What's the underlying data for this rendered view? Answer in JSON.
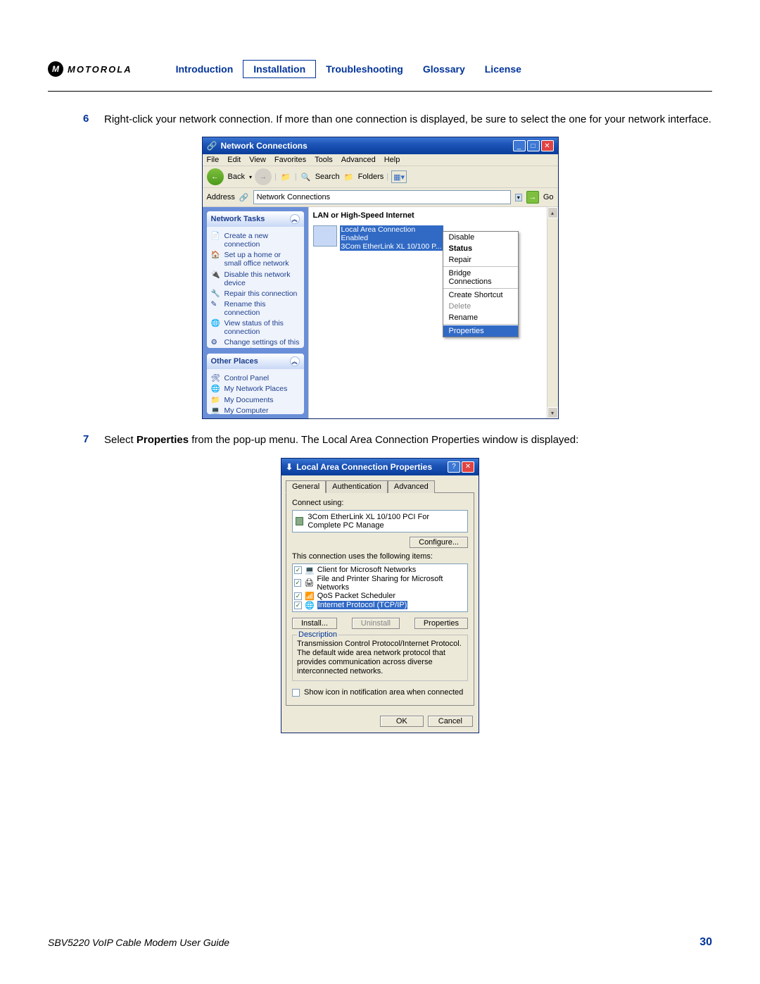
{
  "header": {
    "brand": "MOTOROLA",
    "nav": {
      "introduction": "Introduction",
      "installation": "Installation",
      "troubleshooting": "Troubleshooting",
      "glossary": "Glossary",
      "license": "License"
    }
  },
  "steps": {
    "s6_num": "6",
    "s6_text": "Right-click your network connection. If more than one connection is displayed, be sure to select the one for your network interface.",
    "s7_num": "7",
    "s7_prefix": "Select ",
    "s7_bold": "Properties",
    "s7_suffix": " from the pop-up menu. The Local Area Connection Properties window is displayed:"
  },
  "win1": {
    "title": "Network Connections",
    "menus": {
      "m0": "File",
      "m1": "Edit",
      "m2": "View",
      "m3": "Favorites",
      "m4": "Tools",
      "m5": "Advanced",
      "m6": "Help"
    },
    "toolbar": {
      "back": "Back",
      "search": "Search",
      "folders": "Folders"
    },
    "addr_label": "Address",
    "addr_value": "Network Connections",
    "go": "Go",
    "panel_tasks": "Network Tasks",
    "tasks": {
      "t0": "Create a new connection",
      "t1": "Set up a home or small office network",
      "t2": "Disable this network device",
      "t3": "Repair this connection",
      "t4": "Rename this connection",
      "t5": "View status of this connection",
      "t6": "Change settings of this connection"
    },
    "panel_other": "Other Places",
    "other": {
      "o0": "Control Panel",
      "o1": "My Network Places",
      "o2": "My Documents",
      "o3": "My Computer"
    },
    "main_header": "LAN or High-Speed Internet",
    "conn": {
      "l0": "Local Area Connection",
      "l1": "Enabled",
      "l2": "3Com EtherLink XL 10/100 P..."
    },
    "ctx": {
      "c0": "Disable",
      "c1": "Status",
      "c2": "Repair",
      "c3": "Bridge Connections",
      "c4": "Create Shortcut",
      "c5": "Delete",
      "c6": "Rename",
      "c7": "Properties"
    }
  },
  "win2": {
    "title": "Local Area Connection Properties",
    "tabs": {
      "t0": "General",
      "t1": "Authentication",
      "t2": "Advanced"
    },
    "connect_using": "Connect using:",
    "nic": "3Com EtherLink XL 10/100 PCI For Complete PC Manage",
    "configure": "Configure...",
    "items_label": "This connection uses the following items:",
    "items": {
      "i0": "Client for Microsoft Networks",
      "i1": "File and Printer Sharing for Microsoft Networks",
      "i2": "QoS Packet Scheduler",
      "i3": "Internet Protocol (TCP/IP)"
    },
    "btn_install": "Install...",
    "btn_uninstall": "Uninstall",
    "btn_properties": "Properties",
    "desc_label": "Description",
    "desc": "Transmission Control Protocol/Internet Protocol. The default wide area network protocol that provides communication across diverse interconnected networks.",
    "show_icon": "Show icon in notification area when connected",
    "ok": "OK",
    "cancel": "Cancel"
  },
  "footer": {
    "title": "SBV5220 VoIP Cable Modem User Guide",
    "page": "30"
  }
}
